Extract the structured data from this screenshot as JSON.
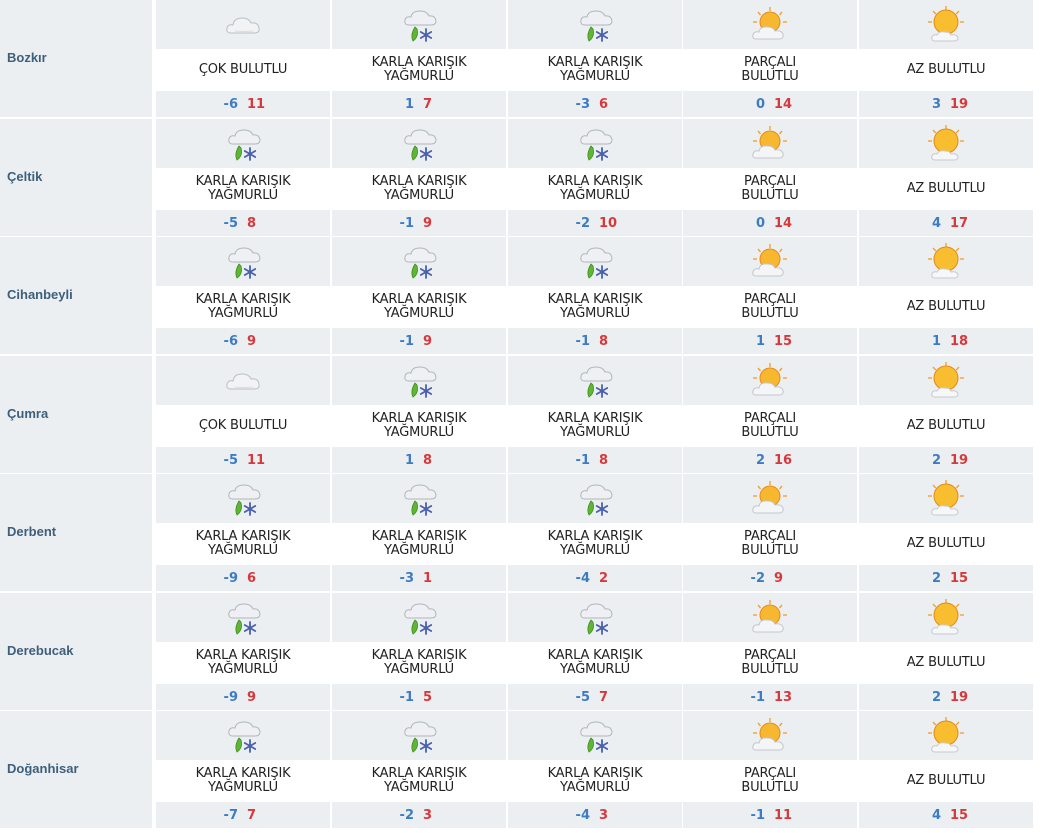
{
  "colors": {
    "min_temp": "#3d7cc3",
    "max_temp": "#d6393c",
    "city": "#3e5f7b",
    "band": "#eceff2"
  },
  "rows": [
    {
      "city": "Bozkır",
      "days": [
        {
          "icon": "cloudy-icon",
          "desc": "ÇOK BULUTLU",
          "min": "-6",
          "max": "11"
        },
        {
          "icon": "sleet-icon",
          "desc": "KARLA KARIŞIK YAĞMURLU",
          "min": "1",
          "max": "7"
        },
        {
          "icon": "sleet-icon",
          "desc": "KARLA KARIŞIK YAĞMURLU",
          "min": "-3",
          "max": "6"
        },
        {
          "icon": "partly-cloudy-icon",
          "desc": "PARÇALI BULUTLU",
          "min": "0",
          "max": "14"
        },
        {
          "icon": "mostly-sunny-icon",
          "desc": "AZ BULUTLU",
          "min": "3",
          "max": "19"
        }
      ]
    },
    {
      "city": "Çeltik",
      "days": [
        {
          "icon": "sleet-icon",
          "desc": "KARLA KARIŞIK YAĞMURLU",
          "min": "-5",
          "max": "8"
        },
        {
          "icon": "sleet-icon",
          "desc": "KARLA KARIŞIK YAĞMURLU",
          "min": "-1",
          "max": "9"
        },
        {
          "icon": "sleet-icon",
          "desc": "KARLA KARIŞIK YAĞMURLU",
          "min": "-2",
          "max": "10"
        },
        {
          "icon": "partly-cloudy-icon",
          "desc": "PARÇALI BULUTLU",
          "min": "0",
          "max": "14"
        },
        {
          "icon": "mostly-sunny-icon",
          "desc": "AZ BULUTLU",
          "min": "4",
          "max": "17"
        }
      ]
    },
    {
      "city": "Cihanbeyli",
      "days": [
        {
          "icon": "sleet-icon",
          "desc": "KARLA KARIŞIK YAĞMURLU",
          "min": "-6",
          "max": "9"
        },
        {
          "icon": "sleet-icon",
          "desc": "KARLA KARIŞIK YAĞMURLU",
          "min": "-1",
          "max": "9"
        },
        {
          "icon": "sleet-icon",
          "desc": "KARLA KARIŞIK YAĞMURLU",
          "min": "-1",
          "max": "8"
        },
        {
          "icon": "partly-cloudy-icon",
          "desc": "PARÇALI BULUTLU",
          "min": "1",
          "max": "15"
        },
        {
          "icon": "mostly-sunny-icon",
          "desc": "AZ BULUTLU",
          "min": "1",
          "max": "18"
        }
      ]
    },
    {
      "city": "Çumra",
      "days": [
        {
          "icon": "cloudy-icon",
          "desc": "ÇOK BULUTLU",
          "min": "-5",
          "max": "11"
        },
        {
          "icon": "sleet-icon",
          "desc": "KARLA KARIŞIK YAĞMURLU",
          "min": "1",
          "max": "8"
        },
        {
          "icon": "sleet-icon",
          "desc": "KARLA KARIŞIK YAĞMURLU",
          "min": "-1",
          "max": "8"
        },
        {
          "icon": "partly-cloudy-icon",
          "desc": "PARÇALI BULUTLU",
          "min": "2",
          "max": "16"
        },
        {
          "icon": "mostly-sunny-icon",
          "desc": "AZ BULUTLU",
          "min": "2",
          "max": "19"
        }
      ]
    },
    {
      "city": "Derbent",
      "days": [
        {
          "icon": "sleet-icon",
          "desc": "KARLA KARIŞIK YAĞMURLU",
          "min": "-9",
          "max": "6"
        },
        {
          "icon": "sleet-icon",
          "desc": "KARLA KARIŞIK YAĞMURLU",
          "min": "-3",
          "max": "1"
        },
        {
          "icon": "sleet-icon",
          "desc": "KARLA KARIŞIK YAĞMURLU",
          "min": "-4",
          "max": "2"
        },
        {
          "icon": "partly-cloudy-icon",
          "desc": "PARÇALI BULUTLU",
          "min": "-2",
          "max": "9"
        },
        {
          "icon": "mostly-sunny-icon",
          "desc": "AZ BULUTLU",
          "min": "2",
          "max": "15"
        }
      ]
    },
    {
      "city": "Derebucak",
      "days": [
        {
          "icon": "sleet-icon",
          "desc": "KARLA KARIŞIK YAĞMURLU",
          "min": "-9",
          "max": "9"
        },
        {
          "icon": "sleet-icon",
          "desc": "KARLA KARIŞIK YAĞMURLU",
          "min": "-1",
          "max": "5"
        },
        {
          "icon": "sleet-icon",
          "desc": "KARLA KARIŞIK YAĞMURLU",
          "min": "-5",
          "max": "7"
        },
        {
          "icon": "partly-cloudy-icon",
          "desc": "PARÇALI BULUTLU",
          "min": "-1",
          "max": "13"
        },
        {
          "icon": "mostly-sunny-icon",
          "desc": "AZ BULUTLU",
          "min": "2",
          "max": "19"
        }
      ]
    },
    {
      "city": "Doğanhisar",
      "days": [
        {
          "icon": "sleet-icon",
          "desc": "KARLA KARIŞIK YAĞMURLU",
          "min": "-7",
          "max": "7"
        },
        {
          "icon": "sleet-icon",
          "desc": "KARLA KARIŞIK YAĞMURLU",
          "min": "-2",
          "max": "3"
        },
        {
          "icon": "sleet-icon",
          "desc": "KARLA KARIŞIK YAĞMURLU",
          "min": "-4",
          "max": "3"
        },
        {
          "icon": "partly-cloudy-icon",
          "desc": "PARÇALI BULUTLU",
          "min": "-1",
          "max": "11"
        },
        {
          "icon": "mostly-sunny-icon",
          "desc": "AZ BULUTLU",
          "min": "4",
          "max": "15"
        }
      ]
    }
  ]
}
